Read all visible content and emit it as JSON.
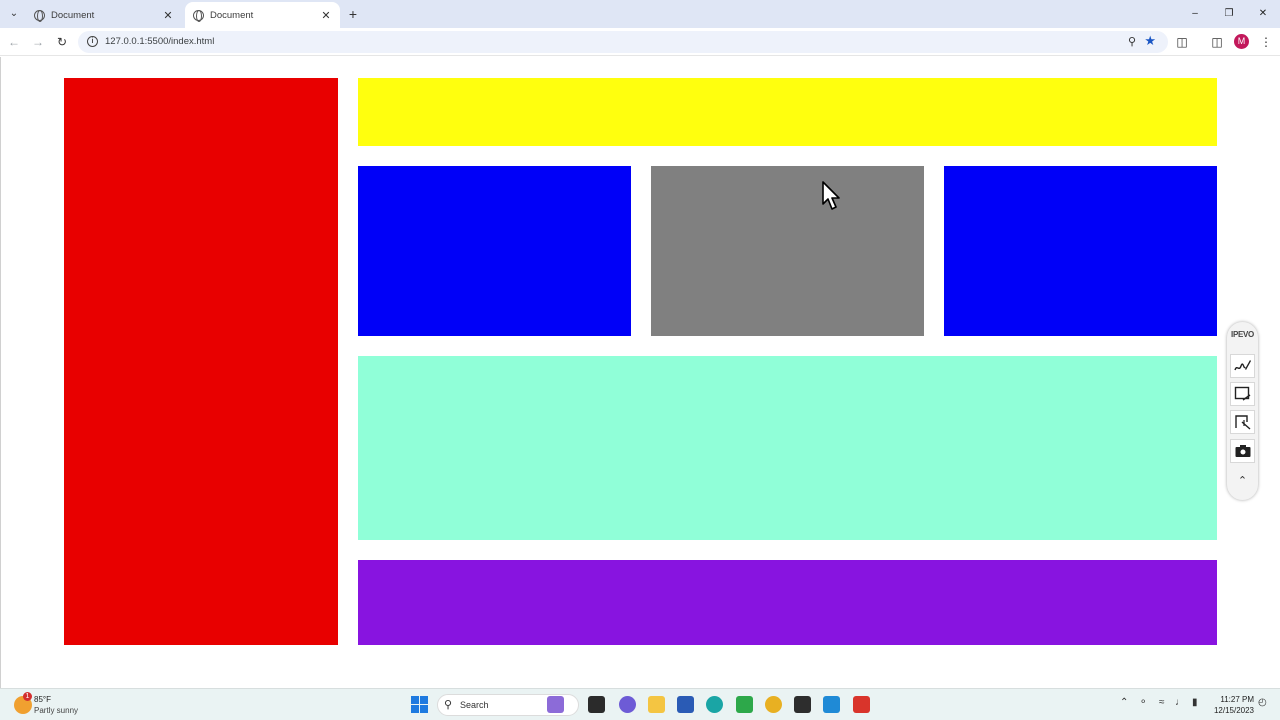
{
  "browser": {
    "tabs": [
      {
        "title": "Document",
        "active": false
      },
      {
        "title": "Document",
        "active": true
      }
    ],
    "url": "127.0.0.1:5500/index.html",
    "avatar_initial": "M"
  },
  "layout_boxes": {
    "sidebar_color": "#e80000",
    "header_color": "#ffff0e",
    "card_left_color": "#0000f8",
    "card_middle_color": "#808080",
    "card_right_color": "#0000f8",
    "main_color": "#90ffd8",
    "footer_color": "#8814e0"
  },
  "ipevo_panel": {
    "brand": "IPEVO",
    "tools": [
      "annotate-icon",
      "capture-region-icon",
      "snip-icon",
      "camera-icon"
    ],
    "collapse": "chevron-up-icon"
  },
  "taskbar": {
    "weather_temp": "85°F",
    "weather_desc": "Partly sunny",
    "weather_badge": "1",
    "search_label": "Search",
    "time": "11:27 PM",
    "date": "12/15/2023"
  }
}
